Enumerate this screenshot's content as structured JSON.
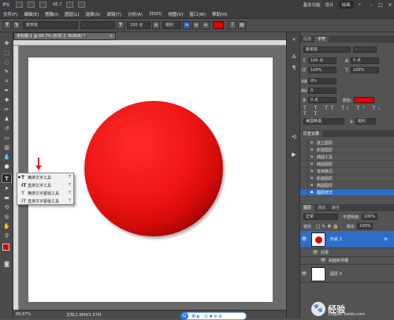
{
  "titlebar": {
    "logo": "PS",
    "zoom": "66.7",
    "workspace_labels": [
      "基本功能",
      "设计",
      "绘画"
    ],
    "active_workspace": "绘画"
  },
  "menubar": {
    "items": [
      "文件(F)",
      "编辑(E)",
      "图像(I)",
      "图层(L)",
      "选择(S)",
      "滤镜(T)",
      "分析(A)",
      "3D(D)",
      "视图(V)",
      "窗口(W)",
      "帮助(H)"
    ]
  },
  "options": {
    "font_family": "新宋体",
    "font_style": "-",
    "font_size": "100 点",
    "antialias": "锐利",
    "text_color": "#e60000"
  },
  "document": {
    "tab_title": "未标题-1 @ 66.7% (形状 2, RGB/8) *",
    "close": "×",
    "zoom_status": "66.67%",
    "doc_size": "文档:2.86M/1.67M"
  },
  "flyout": {
    "items": [
      {
        "label": "横排文字工具",
        "key": "T",
        "selected": true
      },
      {
        "label": "直排文字工具",
        "key": "T",
        "selected": false
      },
      {
        "label": "横排文字蒙版工具",
        "key": "T",
        "selected": false
      },
      {
        "label": "直排文字蒙版工具",
        "key": "T",
        "selected": false
      }
    ]
  },
  "char_panel": {
    "tabs": [
      "段落",
      "字符",
      "字符"
    ],
    "active_tab": "字符",
    "font": "新宋体",
    "size": "100 点",
    "leading": "5 点",
    "scale_v": "100%",
    "scale_h": "100%",
    "tracking": "0%",
    "kerning": "0",
    "baseline": "0 点",
    "color_label": "颜色:",
    "color": "#e60000",
    "language": "美国英语",
    "aa": "锐利"
  },
  "history_panel": {
    "title": "历史记录",
    "items": [
      "建立图层",
      "新建图层",
      "椭圆工具",
      "椭圆图层",
      "变换路径",
      "新建图层",
      "椭圆图层",
      "图层样式"
    ],
    "selected_index": 7
  },
  "layers_panel": {
    "tabs": [
      "图层",
      "通道",
      "路径"
    ],
    "blend_mode": "正常",
    "opacity_label": "不透明度:",
    "opacity": "100%",
    "lock_label": "锁定:",
    "fill_label": "填充:",
    "fill": "100%",
    "layers": [
      {
        "name": "形状 2",
        "fx": "fx",
        "selected": true
      },
      {
        "name": "效果",
        "sub": true
      },
      {
        "name": "斜面和浮雕",
        "sub": true
      },
      {
        "name": "图层 0",
        "selected": false
      }
    ]
  },
  "ime": {
    "logo": "Q",
    "text": "英 ◐ , ☺ ✱ ⚙ ⊞"
  },
  "watermark": {
    "brand": "经验",
    "url": "jingyan.baidu.com"
  }
}
